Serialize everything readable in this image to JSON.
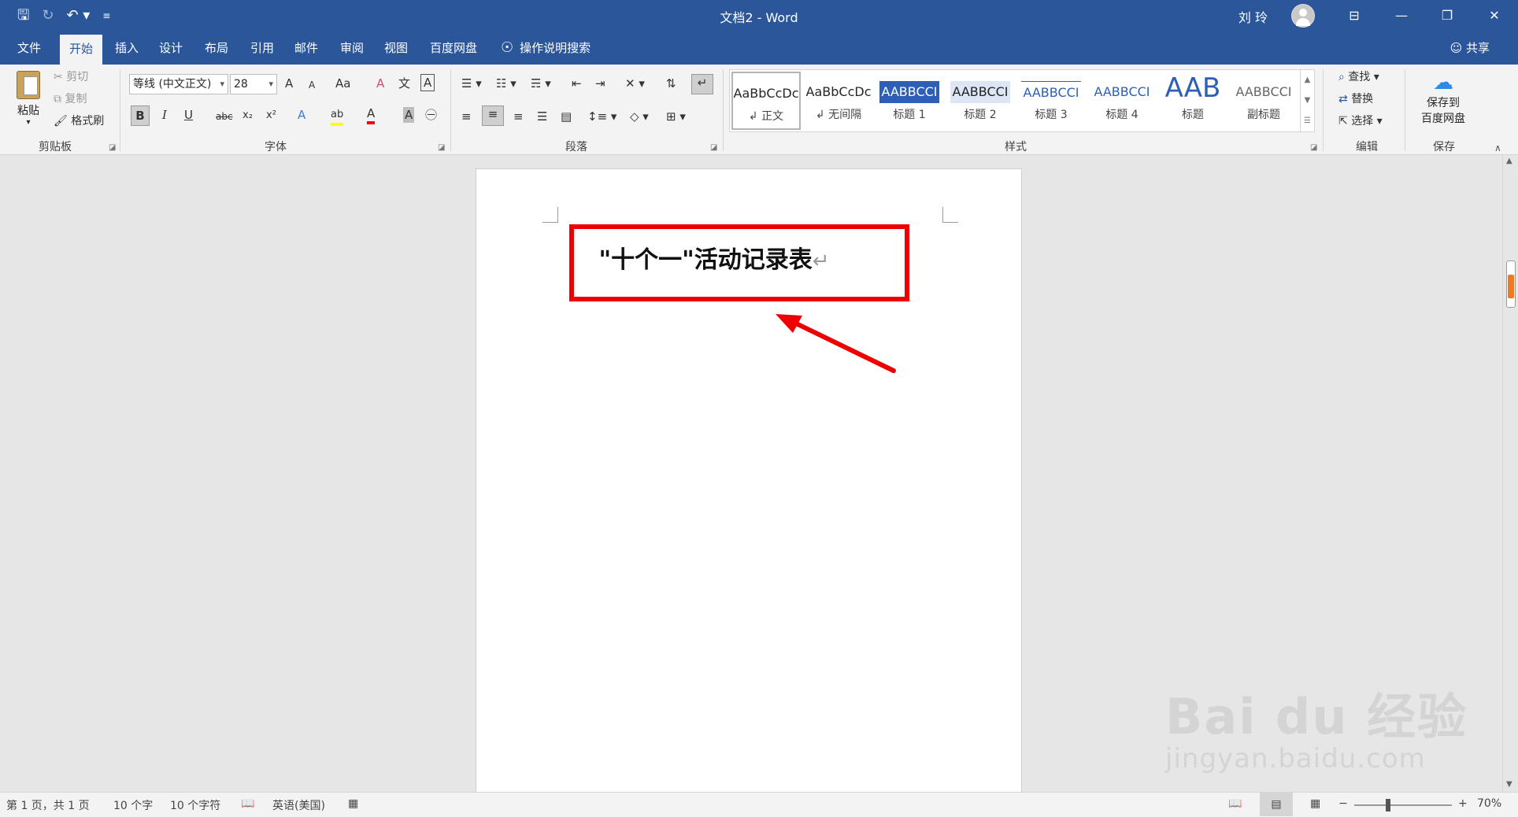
{
  "titlebar": {
    "title": "文档2 - Word",
    "user": "刘 玲",
    "qa_save": "🖫",
    "qa_redo": "↻",
    "qa_undo": "↶ ▾",
    "qa_more": "≡",
    "win_ribbon_options": "⊟",
    "win_minimize": "—",
    "win_restore": "❐",
    "win_close": "✕"
  },
  "tabs": [
    "文件",
    "开始",
    "插入",
    "设计",
    "布局",
    "引用",
    "邮件",
    "审阅",
    "视图",
    "百度网盘"
  ],
  "tellme": "操作说明搜索",
  "share": "共享",
  "clipboard": {
    "paste": "粘贴",
    "cut": "剪切",
    "copy": "复制",
    "format_painter": "格式刷",
    "label": "剪贴板"
  },
  "font": {
    "name": "等线 (中文正文)",
    "size": "28",
    "grow": "A",
    "shrink": "A",
    "change_case": "Aa",
    "clear": "A",
    "phonetic": "文",
    "border": "A",
    "bold": "B",
    "italic": "I",
    "underline": "U",
    "strike": "abc",
    "subscript": "x₂",
    "superscript": "x²",
    "effects": "A",
    "highlight": "ab",
    "color": "A",
    "shading": "A",
    "enclose": "㊀",
    "label": "字体"
  },
  "paragraph": {
    "label": "段落"
  },
  "styles": {
    "label": "样式",
    "items": [
      {
        "sample": "AaBbCcDc",
        "name": "↲ 正文"
      },
      {
        "sample": "AaBbCcDc",
        "name": "↲ 无间隔"
      },
      {
        "sample": "AABBCCI",
        "name": "标题 1"
      },
      {
        "sample": "AABBCCI",
        "name": "标题 2"
      },
      {
        "sample": "AABBCCI",
        "name": "标题 3"
      },
      {
        "sample": "AABBCCI",
        "name": "标题 4"
      },
      {
        "sample": "AAB",
        "name": "标题"
      },
      {
        "sample": "AABBCCI",
        "name": "副标题"
      }
    ]
  },
  "editing": {
    "find": "查找",
    "replace": "替换",
    "select": "选择",
    "label": "编辑"
  },
  "save_group": {
    "button_line1": "保存到",
    "button_line2": "百度网盘",
    "label": "保存"
  },
  "document": {
    "heading": "\"十个一\"活动记录表",
    "pilcrow": "↵"
  },
  "statusbar": {
    "page": "第 1 页，共 1 页",
    "words": "10 个字",
    "chars": "10 个字符",
    "language": "英语(美国)",
    "zoom": "70%",
    "zoom_minus": "−",
    "zoom_plus": "+"
  },
  "watermark": {
    "logo": "Bai du 经验",
    "url": "jingyan.baidu.com"
  },
  "colors": {
    "accent": "#2b579a",
    "annotation_red": "#ee0000"
  }
}
